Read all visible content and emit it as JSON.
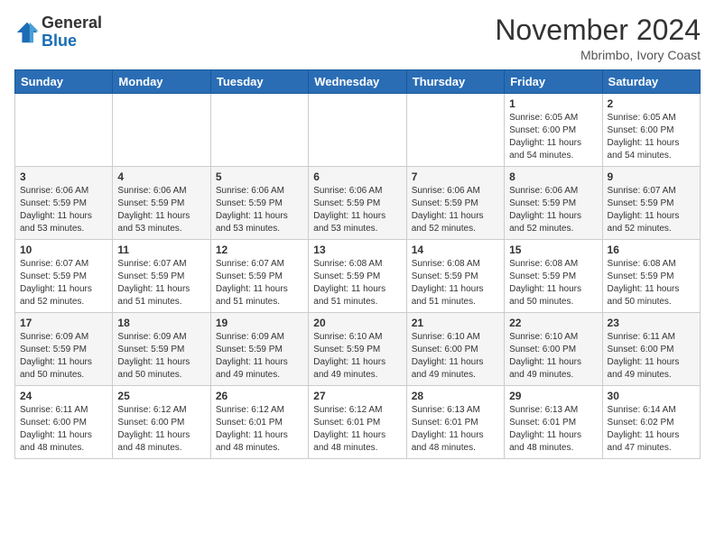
{
  "header": {
    "logo_general": "General",
    "logo_blue": "Blue",
    "month_title": "November 2024",
    "location": "Mbrimbo, Ivory Coast"
  },
  "days_of_week": [
    "Sunday",
    "Monday",
    "Tuesday",
    "Wednesday",
    "Thursday",
    "Friday",
    "Saturday"
  ],
  "weeks": [
    [
      {
        "day": "",
        "info": ""
      },
      {
        "day": "",
        "info": ""
      },
      {
        "day": "",
        "info": ""
      },
      {
        "day": "",
        "info": ""
      },
      {
        "day": "",
        "info": ""
      },
      {
        "day": "1",
        "info": "Sunrise: 6:05 AM\nSunset: 6:00 PM\nDaylight: 11 hours\nand 54 minutes."
      },
      {
        "day": "2",
        "info": "Sunrise: 6:05 AM\nSunset: 6:00 PM\nDaylight: 11 hours\nand 54 minutes."
      }
    ],
    [
      {
        "day": "3",
        "info": "Sunrise: 6:06 AM\nSunset: 5:59 PM\nDaylight: 11 hours\nand 53 minutes."
      },
      {
        "day": "4",
        "info": "Sunrise: 6:06 AM\nSunset: 5:59 PM\nDaylight: 11 hours\nand 53 minutes."
      },
      {
        "day": "5",
        "info": "Sunrise: 6:06 AM\nSunset: 5:59 PM\nDaylight: 11 hours\nand 53 minutes."
      },
      {
        "day": "6",
        "info": "Sunrise: 6:06 AM\nSunset: 5:59 PM\nDaylight: 11 hours\nand 53 minutes."
      },
      {
        "day": "7",
        "info": "Sunrise: 6:06 AM\nSunset: 5:59 PM\nDaylight: 11 hours\nand 52 minutes."
      },
      {
        "day": "8",
        "info": "Sunrise: 6:06 AM\nSunset: 5:59 PM\nDaylight: 11 hours\nand 52 minutes."
      },
      {
        "day": "9",
        "info": "Sunrise: 6:07 AM\nSunset: 5:59 PM\nDaylight: 11 hours\nand 52 minutes."
      }
    ],
    [
      {
        "day": "10",
        "info": "Sunrise: 6:07 AM\nSunset: 5:59 PM\nDaylight: 11 hours\nand 52 minutes."
      },
      {
        "day": "11",
        "info": "Sunrise: 6:07 AM\nSunset: 5:59 PM\nDaylight: 11 hours\nand 51 minutes."
      },
      {
        "day": "12",
        "info": "Sunrise: 6:07 AM\nSunset: 5:59 PM\nDaylight: 11 hours\nand 51 minutes."
      },
      {
        "day": "13",
        "info": "Sunrise: 6:08 AM\nSunset: 5:59 PM\nDaylight: 11 hours\nand 51 minutes."
      },
      {
        "day": "14",
        "info": "Sunrise: 6:08 AM\nSunset: 5:59 PM\nDaylight: 11 hours\nand 51 minutes."
      },
      {
        "day": "15",
        "info": "Sunrise: 6:08 AM\nSunset: 5:59 PM\nDaylight: 11 hours\nand 50 minutes."
      },
      {
        "day": "16",
        "info": "Sunrise: 6:08 AM\nSunset: 5:59 PM\nDaylight: 11 hours\nand 50 minutes."
      }
    ],
    [
      {
        "day": "17",
        "info": "Sunrise: 6:09 AM\nSunset: 5:59 PM\nDaylight: 11 hours\nand 50 minutes."
      },
      {
        "day": "18",
        "info": "Sunrise: 6:09 AM\nSunset: 5:59 PM\nDaylight: 11 hours\nand 50 minutes."
      },
      {
        "day": "19",
        "info": "Sunrise: 6:09 AM\nSunset: 5:59 PM\nDaylight: 11 hours\nand 49 minutes."
      },
      {
        "day": "20",
        "info": "Sunrise: 6:10 AM\nSunset: 5:59 PM\nDaylight: 11 hours\nand 49 minutes."
      },
      {
        "day": "21",
        "info": "Sunrise: 6:10 AM\nSunset: 6:00 PM\nDaylight: 11 hours\nand 49 minutes."
      },
      {
        "day": "22",
        "info": "Sunrise: 6:10 AM\nSunset: 6:00 PM\nDaylight: 11 hours\nand 49 minutes."
      },
      {
        "day": "23",
        "info": "Sunrise: 6:11 AM\nSunset: 6:00 PM\nDaylight: 11 hours\nand 49 minutes."
      }
    ],
    [
      {
        "day": "24",
        "info": "Sunrise: 6:11 AM\nSunset: 6:00 PM\nDaylight: 11 hours\nand 48 minutes."
      },
      {
        "day": "25",
        "info": "Sunrise: 6:12 AM\nSunset: 6:00 PM\nDaylight: 11 hours\nand 48 minutes."
      },
      {
        "day": "26",
        "info": "Sunrise: 6:12 AM\nSunset: 6:01 PM\nDaylight: 11 hours\nand 48 minutes."
      },
      {
        "day": "27",
        "info": "Sunrise: 6:12 AM\nSunset: 6:01 PM\nDaylight: 11 hours\nand 48 minutes."
      },
      {
        "day": "28",
        "info": "Sunrise: 6:13 AM\nSunset: 6:01 PM\nDaylight: 11 hours\nand 48 minutes."
      },
      {
        "day": "29",
        "info": "Sunrise: 6:13 AM\nSunset: 6:01 PM\nDaylight: 11 hours\nand 48 minutes."
      },
      {
        "day": "30",
        "info": "Sunrise: 6:14 AM\nSunset: 6:02 PM\nDaylight: 11 hours\nand 47 minutes."
      }
    ]
  ]
}
